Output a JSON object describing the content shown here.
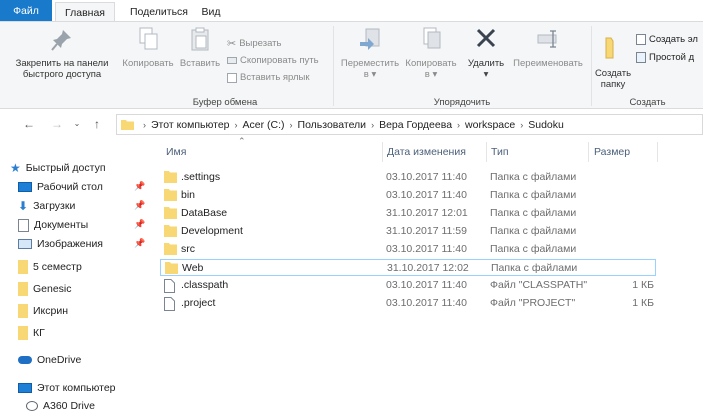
{
  "ribbon_tabs": {
    "file": "Файл",
    "home": "Главная",
    "share": "Поделиться",
    "view": "Вид"
  },
  "ribbon": {
    "pin_quick_access": [
      "Закрепить на панели",
      "быстрого доступа"
    ],
    "copy": "Копировать",
    "paste": "Вставить",
    "cut": "Вырезать",
    "copy_path": "Скопировать путь",
    "paste_shortcut": "Вставить ярлык",
    "clipboard_group": "Буфер обмена",
    "move_to": "Переместить",
    "copy_to": "Копировать",
    "in": "в",
    "delete": "Удалить",
    "rename": "Переименовать",
    "organize_group": "Упорядочить",
    "new_folder": [
      "Создать",
      "папку"
    ],
    "new_item": "Создать эл",
    "easy_access": "Простой д",
    "create_group": "Создать"
  },
  "address": {
    "crumbs": [
      "Этот компьютер",
      "Acer (C:)",
      "Пользователи",
      "Вера Гордеева",
      "workspace",
      "Sudoku"
    ]
  },
  "nav_pane": {
    "items": [
      {
        "label": "Быстрый доступ",
        "icon": "star-icon"
      },
      {
        "label": "Рабочий стол",
        "icon": "desktop-icon",
        "pinned": true
      },
      {
        "label": "Загрузки",
        "icon": "download-icon",
        "pinned": true
      },
      {
        "label": "Документы",
        "icon": "documents-icon",
        "pinned": true
      },
      {
        "label": "Изображения",
        "icon": "pictures-icon",
        "pinned": true
      },
      {
        "label": "5 семестр",
        "icon": "folder-icon"
      },
      {
        "label": "Genesic",
        "icon": "folder-icon"
      },
      {
        "label": "Иксрин",
        "icon": "folder-icon"
      },
      {
        "label": "КГ",
        "icon": "folder-icon"
      },
      {
        "label": "OneDrive",
        "icon": "cloud-icon"
      },
      {
        "label": "Этот компьютер",
        "icon": "computer-icon"
      },
      {
        "label": "A360 Drive",
        "icon": "drive-icon"
      }
    ]
  },
  "columns": {
    "name": "Имя",
    "date": "Дата изменения",
    "type": "Тип",
    "size": "Размер"
  },
  "files": [
    {
      "name": ".settings",
      "date": "03.10.2017 11:40",
      "type": "Папка с файлами",
      "size": "",
      "kind": "folder"
    },
    {
      "name": "bin",
      "date": "03.10.2017 11:40",
      "type": "Папка с файлами",
      "size": "",
      "kind": "folder"
    },
    {
      "name": "DataBase",
      "date": "31.10.2017 12:01",
      "type": "Папка с файлами",
      "size": "",
      "kind": "folder"
    },
    {
      "name": "Development",
      "date": "31.10.2017 11:59",
      "type": "Папка с файлами",
      "size": "",
      "kind": "folder"
    },
    {
      "name": "src",
      "date": "03.10.2017 11:40",
      "type": "Папка с файлами",
      "size": "",
      "kind": "folder"
    },
    {
      "name": "Web",
      "date": "31.10.2017 12:02",
      "type": "Папка с файлами",
      "size": "",
      "kind": "folder",
      "focused": true
    },
    {
      "name": ".classpath",
      "date": "03.10.2017 11:40",
      "type": "Файл \"CLASSPATH\"",
      "size": "1 КБ",
      "kind": "file"
    },
    {
      "name": ".project",
      "date": "03.10.2017 11:40",
      "type": "Файл \"PROJECT\"",
      "size": "1 КБ",
      "kind": "file"
    }
  ],
  "colors": {
    "file_tab": "#1979ca",
    "folder": "#f8d775",
    "selection_border": "#99d1ff",
    "header_text": "#4c607a"
  }
}
